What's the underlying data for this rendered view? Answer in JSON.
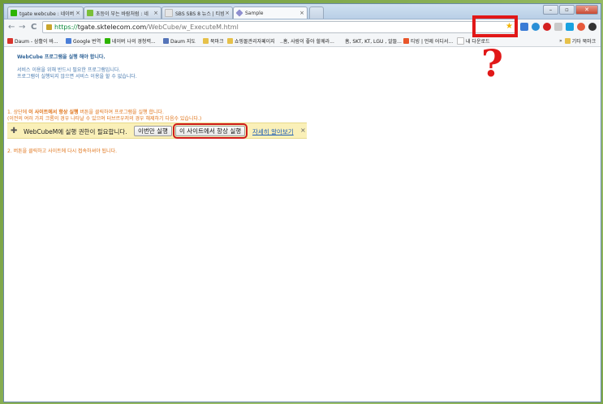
{
  "tabs": [
    {
      "label": "tgate webcube : 네이버 ..",
      "icon_color": "#2db400"
    },
    {
      "label": "초등이 부는 바람처럼 : 네",
      "icon_color": "#7bbf3a"
    },
    {
      "label": "SBS SBS 8 뉴스 | 티빙",
      "icon_color": "#e5e5e5"
    },
    {
      "label": "Sample",
      "icon_color": "#8f8fcf"
    }
  ],
  "window_controls": {
    "minimize": "–",
    "maximize": "▫",
    "close": "✕"
  },
  "nav": {
    "back": "←",
    "forward": "→",
    "reload": "C"
  },
  "address": {
    "scheme": "https://",
    "host": "tgate.sktelecom.com",
    "path": "/WebCube/w_ExecuteM.html"
  },
  "bookmarks": [
    {
      "label": "Daum - 삼활이 바...",
      "icon_color": "#d8342c"
    },
    {
      "label": "Google 번역",
      "icon_color": "#4a7ed8"
    },
    {
      "label": "네이버 나의 경청력...",
      "icon_color": "#2db400"
    },
    {
      "label": "Daum 지도",
      "icon_color": "#5574b9"
    },
    {
      "label": "북마크",
      "icon_color": "#e6c14a"
    },
    {
      "label": "쇼핑몰관리자페이지",
      "icon_color": "#e6c14a"
    },
    {
      "label": "..흠, 사람이 좋아 할께라...",
      "icon_color": "#999999"
    },
    {
      "label": "흠, SKT, KT, LGU , 알뜰...",
      "icon_color": "#999999"
    },
    {
      "label": "티빙 | 언제 어디서...",
      "icon_color": "#e8552a"
    },
    {
      "label": "내 다운로드",
      "icon_color": "#bbbbbb"
    },
    {
      "label": "기타 북마크",
      "icon_color": "#e6c14a"
    }
  ],
  "page": {
    "title": "WebCube 프로그램을 실행 해야 합니다.",
    "desc1": "서비스 이용을 위해 반드시 필요한 프로그램입니다.",
    "desc2": "프로그램이 실행되지 않으면 서비스 이용을 할 수 없습니다.",
    "step1_prefix": "1. 상단에 ",
    "step1_bold": "이 사이트에서 항상 실행",
    "step1_suffix": " 버튼을 클릭하여 프로그램을 실행 합니다.",
    "step1_note": "(이전의 여러 가지 크롬의 경우 나타날 수 있으며 터브르우저의 경우 해제하기 다음수 있습니다.)",
    "step2": "2. 버튼을 클릭하고 사이트에 다시 접속하셔야 됩니다."
  },
  "infobar": {
    "message": "WebCubeM에 실행 권한이 필요합니다.",
    "once_button": "이번만 실행",
    "always_button": "이 사이트에서 항상 실행",
    "learn_more": "자세히 알아보기",
    "close": "×"
  },
  "annotation": {
    "question_mark": "?",
    "highlight_color": "#e11818"
  }
}
